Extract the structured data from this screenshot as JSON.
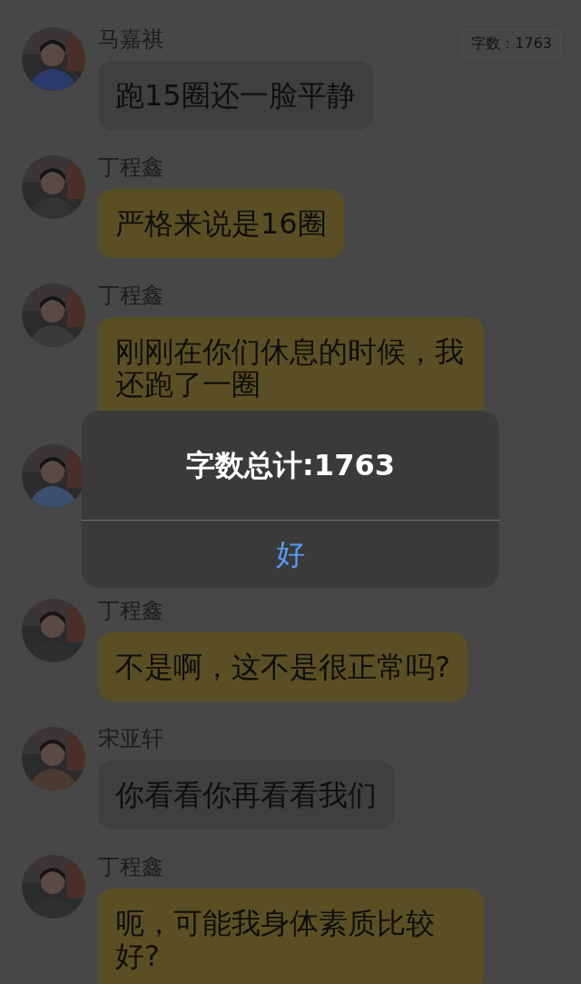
{
  "word_count_badge": "字数：1763",
  "messages": [
    {
      "name": "马嘉祺",
      "text": "跑15圈还一脸平静",
      "kind": "grey"
    },
    {
      "name": "丁程鑫",
      "text": "严格来说是16圈",
      "kind": "yellow"
    },
    {
      "name": "丁程鑫",
      "text": "刚刚在你们休息的时候，我还跑了一圈",
      "kind": "yellow"
    },
    {
      "kind": "hidden"
    },
    {
      "name": "丁程鑫",
      "text": "不是啊，这不是很正常吗?",
      "kind": "yellow"
    },
    {
      "name": "宋亚轩",
      "text": "你看看你再看看我们",
      "kind": "grey"
    },
    {
      "name": "丁程鑫",
      "text": "呃，可能我身体素质比较好?",
      "kind": "yellow"
    }
  ],
  "alert": {
    "title": "字数总计:1763",
    "button": "好"
  }
}
